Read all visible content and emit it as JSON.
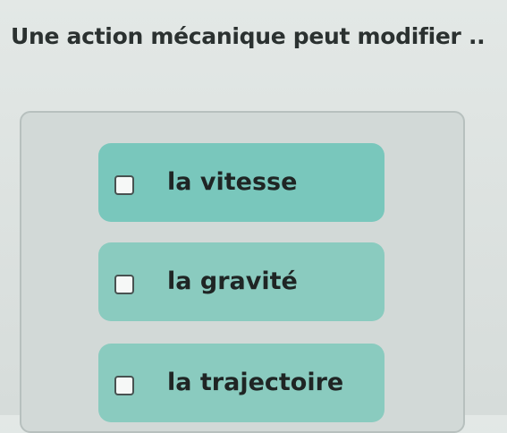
{
  "question": {
    "text": "Une action mécanique peut modifier .."
  },
  "options": [
    {
      "label": "la vitesse",
      "checked": false
    },
    {
      "label": "la gravité",
      "checked": false
    },
    {
      "label": "la trajectoire",
      "checked": false
    }
  ],
  "colors": {
    "option_fill": "#8acbbf",
    "option_fill_highlight": "#79c7bc",
    "card_border": "#b7c0be"
  }
}
